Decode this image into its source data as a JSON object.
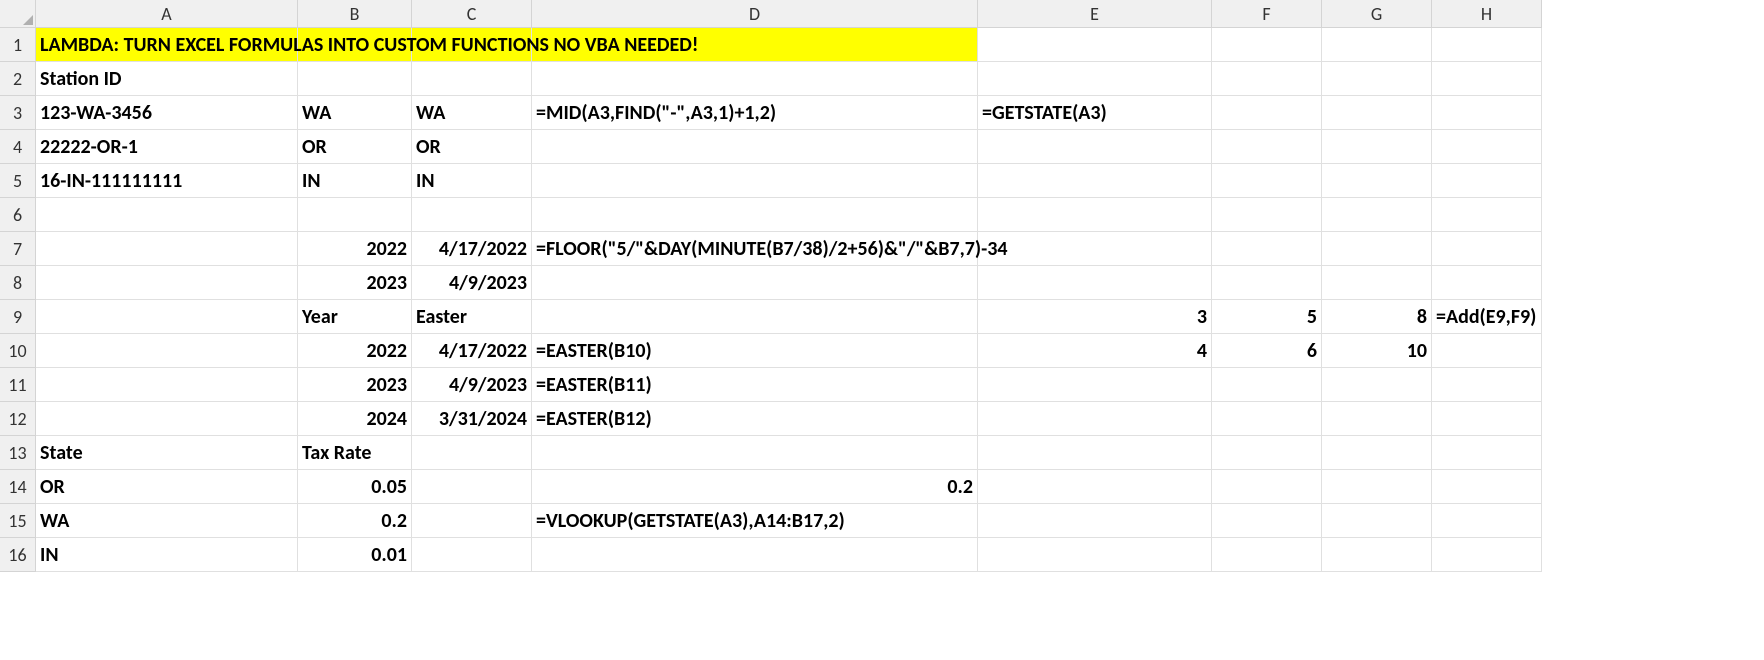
{
  "columns": [
    "A",
    "B",
    "C",
    "D",
    "E",
    "F",
    "G",
    "H"
  ],
  "rows": [
    "1",
    "2",
    "3",
    "4",
    "5",
    "6",
    "7",
    "8",
    "9",
    "10",
    "11",
    "12",
    "13",
    "14",
    "15",
    "16"
  ],
  "cells": {
    "A1": "LAMBDA: TURN EXCEL FORMULAS INTO CUSTOM FUNCTIONS NO VBA NEEDED!",
    "A2": "Station ID",
    "A3": "123-WA-3456",
    "B3": "WA",
    "C3": "WA",
    "D3": "=MID(A3,FIND(\"-\",A3,1)+1,2)",
    "E3": "=GETSTATE(A3)",
    "A4": "22222-OR-1",
    "B4": "OR",
    "C4": "OR",
    "A5": "16-IN-111111111",
    "B5": "IN",
    "C5": "IN",
    "B7": "2022",
    "C7": "4/17/2022",
    "D7": "=FLOOR(\"5/\"&DAY(MINUTE(B7/38)/2+56)&\"/\"&B7,7)-34",
    "B8": "2023",
    "C8": "4/9/2023",
    "B9": "Year",
    "C9": "Easter",
    "E9": "3",
    "F9": "5",
    "G9": "8",
    "H9": "=Add(E9,F9)",
    "B10": "2022",
    "C10": "4/17/2022",
    "D10": "=EASTER(B10)",
    "E10": "4",
    "F10": "6",
    "G10": "10",
    "B11": "2023",
    "C11": "4/9/2023",
    "D11": "=EASTER(B11)",
    "B12": "2024",
    "C12": "3/31/2024",
    "D12": "=EASTER(B12)",
    "A13": "State",
    "B13": "Tax Rate",
    "A14": "OR",
    "B14": "0.05",
    "D14": "0.2",
    "A15": "WA",
    "B15": "0.2",
    "D15": "=VLOOKUP(GETSTATE(A3),A14:B17,2)",
    "A16": "IN",
    "B16": "0.01"
  }
}
